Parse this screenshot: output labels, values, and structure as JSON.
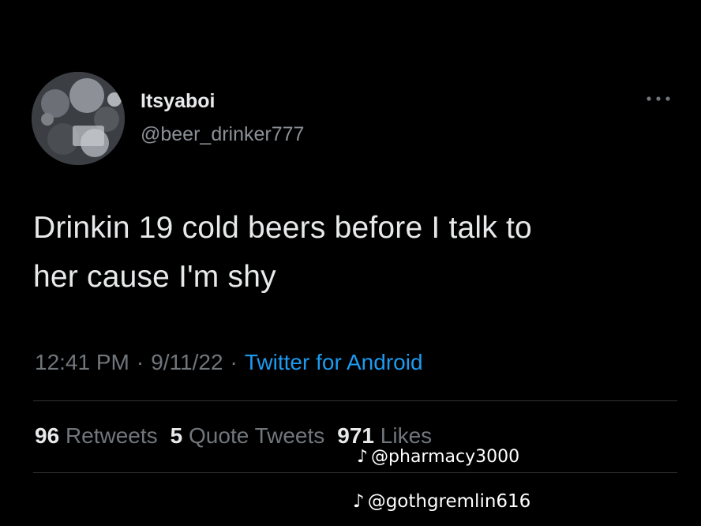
{
  "tweet": {
    "display_name": "Itsyaboi",
    "handle": "@beer_drinker777",
    "text_line1": "Drinkin 19 cold beers before I talk to",
    "text_line2": "her cause I'm shy",
    "time": "12:41 PM",
    "date": "9/11/22",
    "separator": "·",
    "source": "Twitter for Android",
    "more_icon": "more-horizontal-icon"
  },
  "stats": {
    "retweets_count": "96",
    "retweets_label": "Retweets",
    "quotes_count": "5",
    "quotes_label": "Quote Tweets",
    "likes_count": "971",
    "likes_label": "Likes"
  },
  "watermarks": {
    "first_icon": "♪",
    "first": "@pharmacy3000",
    "second_icon": "♪",
    "second": "@gothgremlin616"
  },
  "colors": {
    "background": "#000000",
    "primary_text": "#e7e9ea",
    "secondary_text": "#71767b",
    "link": "#1d9bf0",
    "divider": "#2f3336"
  }
}
